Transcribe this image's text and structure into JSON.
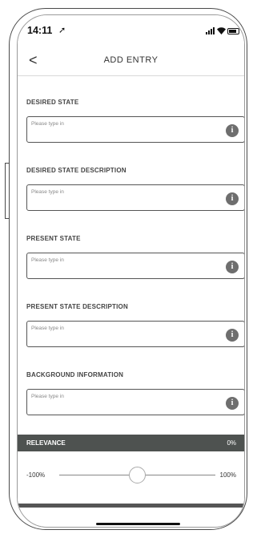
{
  "status": {
    "time": "14:11",
    "location_glyph": "➚"
  },
  "nav": {
    "back_glyph": "<",
    "title": "ADD ENTRY"
  },
  "fields": [
    {
      "label": "DESIRED STATE",
      "placeholder": "Please type in"
    },
    {
      "label": "DESIRED STATE DESCRIPTION",
      "placeholder": "Please type in"
    },
    {
      "label": "PRESENT STATE",
      "placeholder": "Please type in"
    },
    {
      "label": "PRESENT STATE DESCRIPTION",
      "placeholder": "Please type in"
    },
    {
      "label": "BACKGROUND INFORMATION",
      "placeholder": "Please type in"
    }
  ],
  "info_glyph": "i",
  "relevance": {
    "label": "RELEVANCE",
    "value_text": "0%",
    "min_label": "-100%",
    "max_label": "100%",
    "value": 0,
    "min": -100,
    "max": 100
  },
  "colors": {
    "header_bar": "#4e5250",
    "info_icon": "#6e6e6e"
  }
}
